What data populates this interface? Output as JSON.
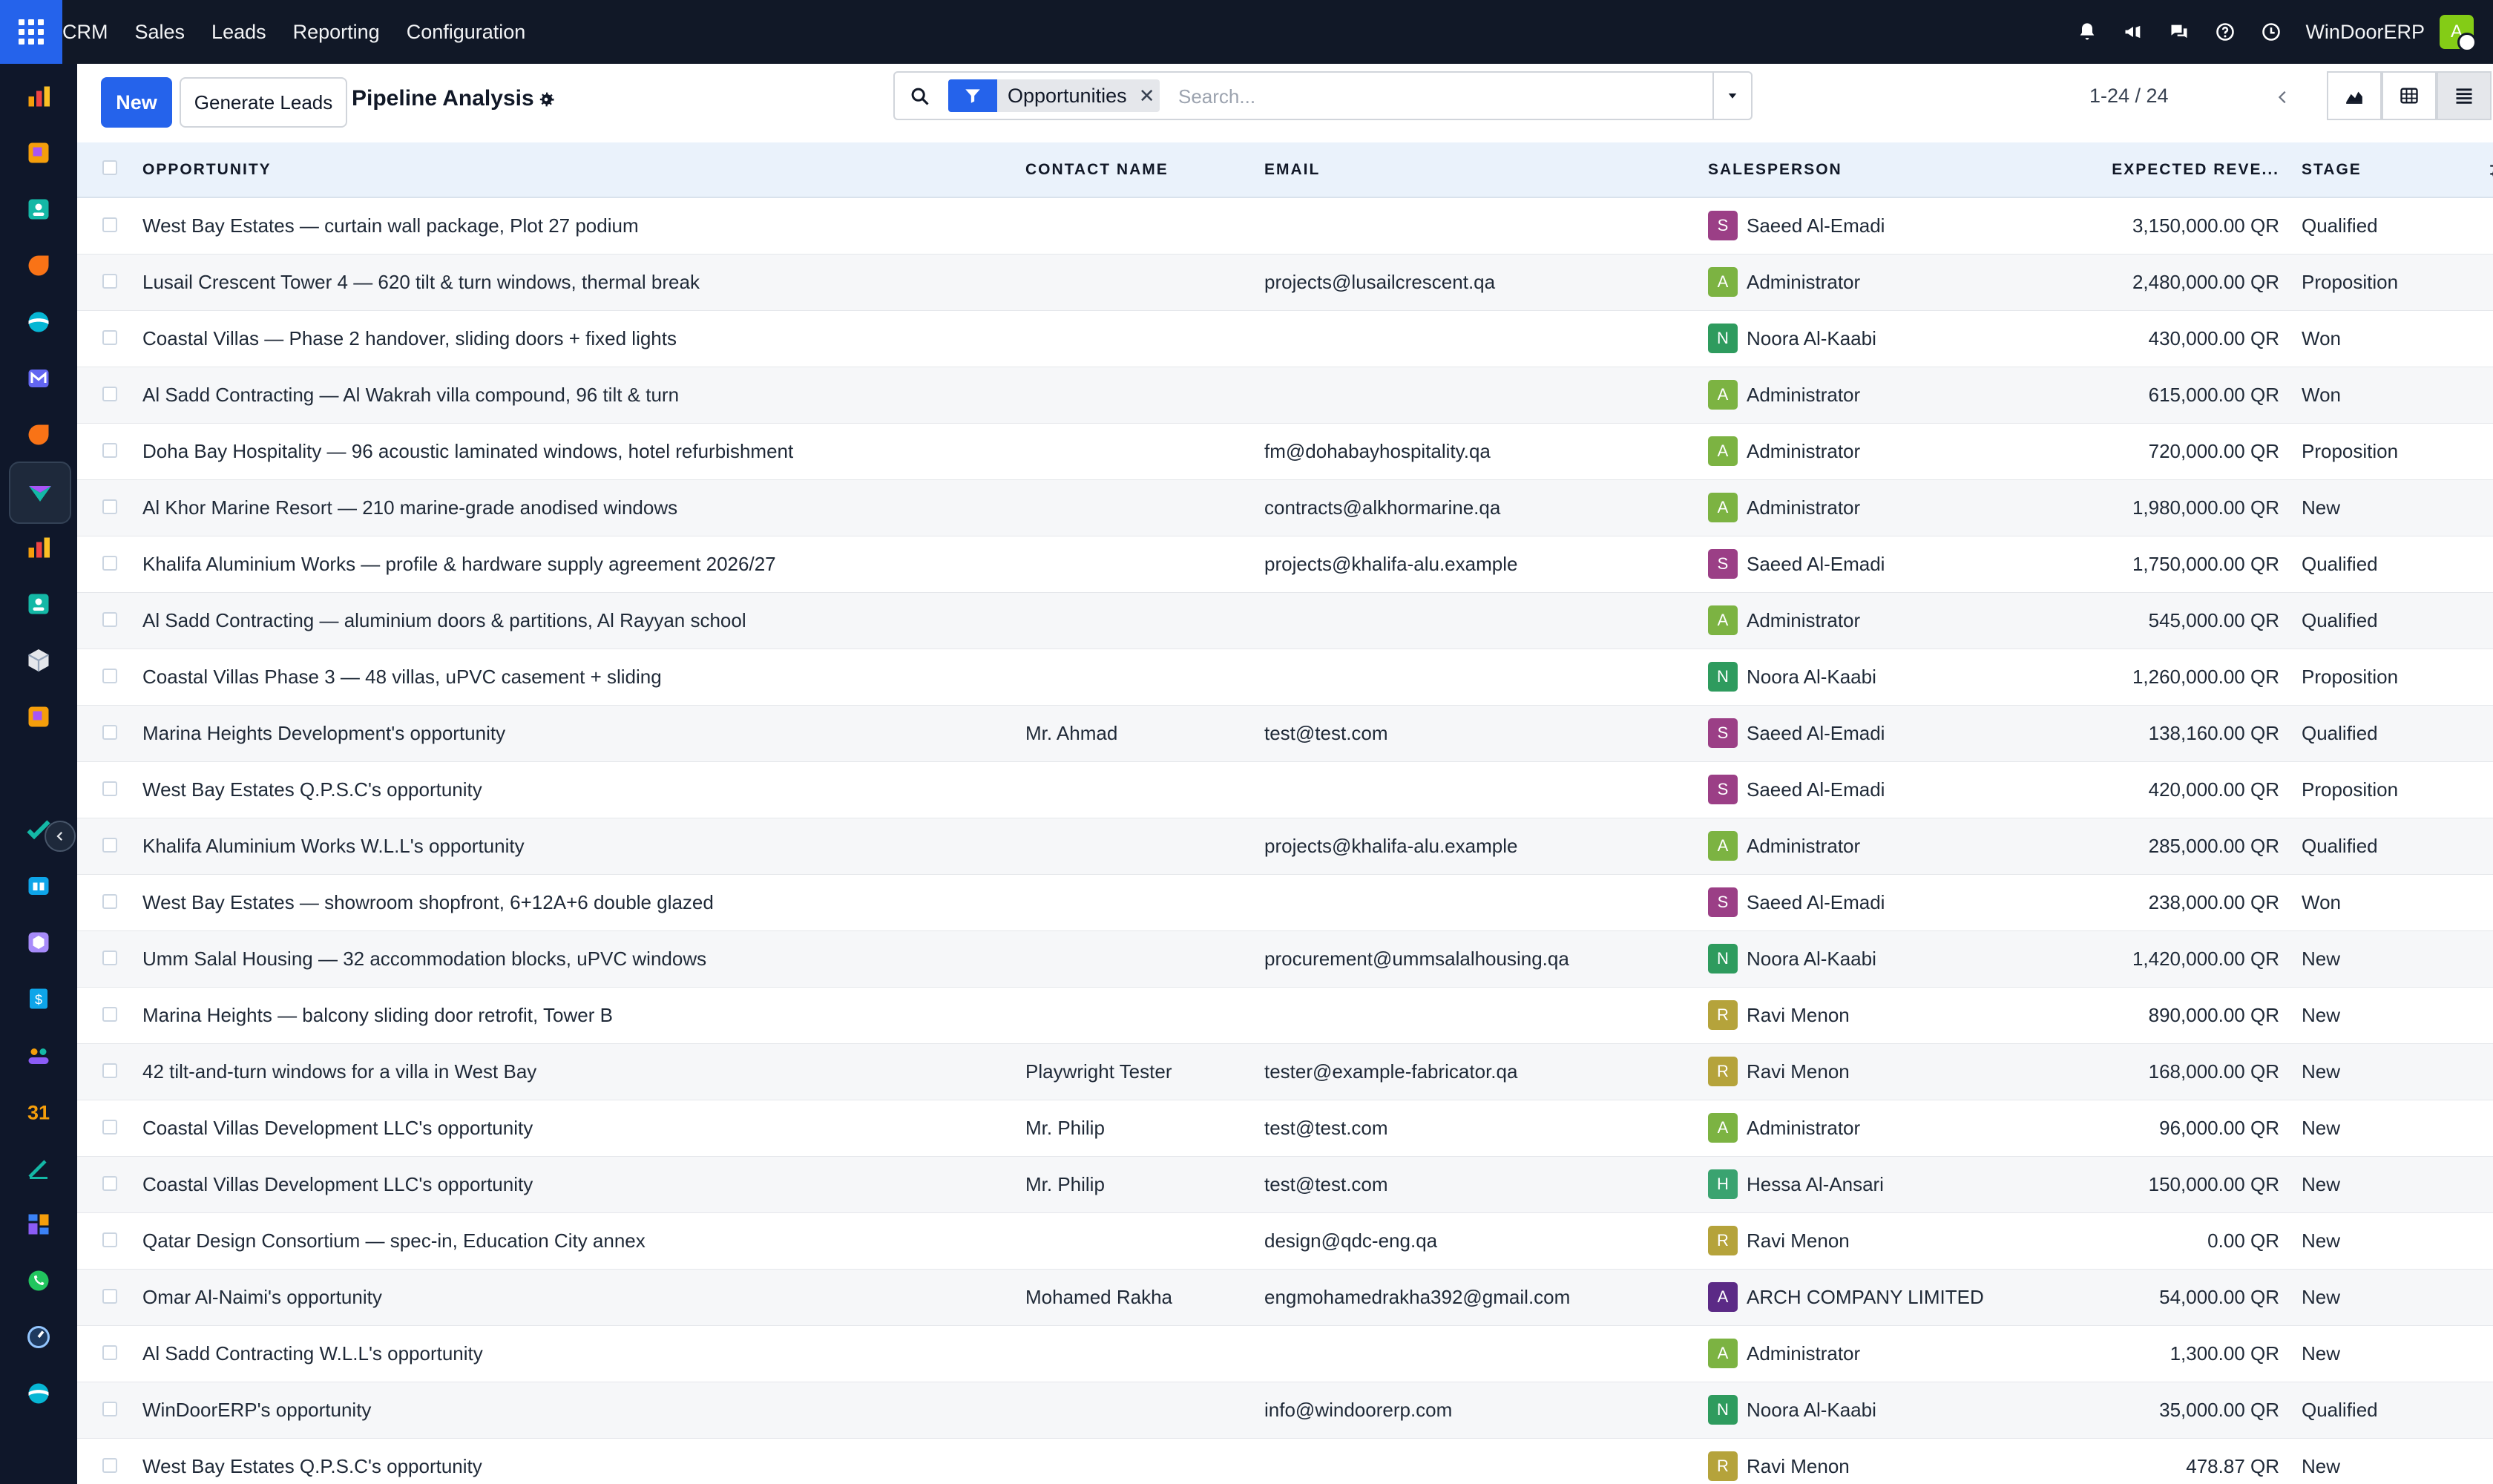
{
  "topbar": {
    "nav": [
      "CRM",
      "Sales",
      "Leads",
      "Reporting",
      "Configuration"
    ],
    "company": "WinDoorERP",
    "user_initial": "A"
  },
  "control": {
    "new_label": "New",
    "generate_label": "Generate Leads",
    "title": "Pipeline Analysis",
    "facet_label": "Opportunities",
    "search_placeholder": "Search...",
    "pager": "1-24 / 24"
  },
  "table": {
    "headers": {
      "opportunity": "OPPORTUNITY",
      "contact": "CONTACT NAME",
      "email": "EMAIL",
      "salesperson": "SALESPERSON",
      "revenue": "EXPECTED REVE...",
      "stage": "STAGE"
    },
    "rows": [
      {
        "opportunity": "West Bay Estates — curtain wall package, Plot 27 podium",
        "contact": "",
        "email": "",
        "initial": "S",
        "salesperson": "Saeed Al-Emadi",
        "revenue": "3,150,000.00 QR",
        "stage": "Qualified"
      },
      {
        "opportunity": "Lusail Crescent Tower 4 — 620 tilt & turn windows, thermal break",
        "contact": "",
        "email": "projects@lusailcrescent.qa",
        "initial": "A",
        "salesperson": "Administrator",
        "revenue": "2,480,000.00 QR",
        "stage": "Proposition"
      },
      {
        "opportunity": "Coastal Villas — Phase 2 handover, sliding doors + fixed lights",
        "contact": "",
        "email": "",
        "initial": "N",
        "salesperson": "Noora Al-Kaabi",
        "revenue": "430,000.00 QR",
        "stage": "Won"
      },
      {
        "opportunity": "Al Sadd Contracting — Al Wakrah villa compound, 96 tilt & turn",
        "contact": "",
        "email": "",
        "initial": "A",
        "salesperson": "Administrator",
        "revenue": "615,000.00 QR",
        "stage": "Won"
      },
      {
        "opportunity": "Doha Bay Hospitality — 96 acoustic laminated windows, hotel refurbishment",
        "contact": "",
        "email": "fm@dohabayhospitality.qa",
        "initial": "A",
        "salesperson": "Administrator",
        "revenue": "720,000.00 QR",
        "stage": "Proposition"
      },
      {
        "opportunity": "Al Khor Marine Resort — 210 marine-grade anodised windows",
        "contact": "",
        "email": "contracts@alkhormarine.qa",
        "initial": "A",
        "salesperson": "Administrator",
        "revenue": "1,980,000.00 QR",
        "stage": "New"
      },
      {
        "opportunity": "Khalifa Aluminium Works — profile & hardware supply agreement 2026/27",
        "contact": "",
        "email": "projects@khalifa-alu.example",
        "initial": "S",
        "salesperson": "Saeed Al-Emadi",
        "revenue": "1,750,000.00 QR",
        "stage": "Qualified"
      },
      {
        "opportunity": "Al Sadd Contracting — aluminium doors & partitions, Al Rayyan school",
        "contact": "",
        "email": "",
        "initial": "A",
        "salesperson": "Administrator",
        "revenue": "545,000.00 QR",
        "stage": "Qualified"
      },
      {
        "opportunity": "Coastal Villas Phase 3 — 48 villas, uPVC casement + sliding",
        "contact": "",
        "email": "",
        "initial": "N",
        "salesperson": "Noora Al-Kaabi",
        "revenue": "1,260,000.00 QR",
        "stage": "Proposition"
      },
      {
        "opportunity": "Marina Heights Development's opportunity",
        "contact": "Mr. Ahmad",
        "email": "test@test.com",
        "initial": "S",
        "salesperson": "Saeed Al-Emadi",
        "revenue": "138,160.00 QR",
        "stage": "Qualified"
      },
      {
        "opportunity": "West Bay Estates Q.P.S.C's opportunity",
        "contact": "",
        "email": "",
        "initial": "S",
        "salesperson": "Saeed Al-Emadi",
        "revenue": "420,000.00 QR",
        "stage": "Proposition"
      },
      {
        "opportunity": "Khalifa Aluminium Works W.L.L's opportunity",
        "contact": "",
        "email": "projects@khalifa-alu.example",
        "initial": "A",
        "salesperson": "Administrator",
        "revenue": "285,000.00 QR",
        "stage": "Qualified"
      },
      {
        "opportunity": "West Bay Estates — showroom shopfront, 6+12A+6 double glazed",
        "contact": "",
        "email": "",
        "initial": "S",
        "salesperson": "Saeed Al-Emadi",
        "revenue": "238,000.00 QR",
        "stage": "Won"
      },
      {
        "opportunity": "Umm Salal Housing — 32 accommodation blocks, uPVC windows",
        "contact": "",
        "email": "procurement@ummsalalhousing.qa",
        "initial": "N",
        "salesperson": "Noora Al-Kaabi",
        "revenue": "1,420,000.00 QR",
        "stage": "New"
      },
      {
        "opportunity": "Marina Heights — balcony sliding door retrofit, Tower B",
        "contact": "",
        "email": "",
        "initial": "R",
        "salesperson": "Ravi Menon",
        "revenue": "890,000.00 QR",
        "stage": "New"
      },
      {
        "opportunity": "42 tilt-and-turn windows for a villa in West Bay",
        "contact": "Playwright Tester",
        "email": "tester@example-fabricator.qa",
        "initial": "R",
        "salesperson": "Ravi Menon",
        "revenue": "168,000.00 QR",
        "stage": "New"
      },
      {
        "opportunity": "Coastal Villas Development LLC's opportunity",
        "contact": "Mr. Philip",
        "email": "test@test.com",
        "initial": "A",
        "salesperson": "Administrator",
        "revenue": "96,000.00 QR",
        "stage": "New"
      },
      {
        "opportunity": "Coastal Villas Development LLC's opportunity",
        "contact": "Mr. Philip",
        "email": "test@test.com",
        "initial": "H",
        "salesperson": "Hessa Al-Ansari",
        "revenue": "150,000.00 QR",
        "stage": "New"
      },
      {
        "opportunity": "Qatar Design Consortium — spec-in, Education City annex",
        "contact": "",
        "email": "design@qdc-eng.qa",
        "initial": "R",
        "salesperson": "Ravi Menon",
        "revenue": "0.00 QR",
        "stage": "New"
      },
      {
        "opportunity": "Omar Al-Naimi's opportunity",
        "contact": "Mohamed Rakha",
        "email": "engmohamedrakha392@gmail.com",
        "initial": "A",
        "salesperson": "ARCH COMPANY LIMITED",
        "revenue": "54,000.00 QR",
        "stage": "New"
      },
      {
        "opportunity": "Al Sadd Contracting W.L.L's opportunity",
        "contact": "",
        "email": "",
        "initial": "A",
        "salesperson": "Administrator",
        "revenue": "1,300.00 QR",
        "stage": "New"
      },
      {
        "opportunity": "WinDoorERP's opportunity",
        "contact": "",
        "email": "info@windoorerp.com",
        "initial": "N",
        "salesperson": "Noora Al-Kaabi",
        "revenue": "35,000.00 QR",
        "stage": "Qualified"
      },
      {
        "opportunity": "West Bay Estates Q.P.S.C's opportunity",
        "contact": "",
        "email": "",
        "initial": "R",
        "salesperson": "Ravi Menon",
        "revenue": "478.87 QR",
        "stage": "New"
      }
    ]
  },
  "salesperson_colors": {
    "Saeed Al-Emadi": "#9b3f86",
    "Administrator": "#7cb342",
    "Noora Al-Kaabi": "#2e9b5e",
    "Ravi Menon": "#b5a33b",
    "Hessa Al-Ansari": "#3aa370",
    "ARCH COMPANY LIMITED": "#5b2a86"
  },
  "sidebar_icons": [
    "dashboard-app-icon",
    "project-app-icon",
    "contacts-app-icon",
    "discuss-app-icon",
    "website-app-icon",
    "email-marketing-app-icon",
    "livechat-app-icon",
    "crm-app-icon",
    "dashboard-app-icon",
    "contacts-app-icon",
    "inventory-app-icon",
    "project-app-icon",
    "todo-app-icon",
    "knowledge-app-icon",
    "barcode-app-icon",
    "invoicing-app-icon",
    "employees-app-icon",
    "calendar-app-icon",
    "sign-app-icon",
    "spreadsheet-app-icon",
    "whatsapp-app-icon",
    "timesheet-app-icon",
    "settings-app-icon"
  ]
}
